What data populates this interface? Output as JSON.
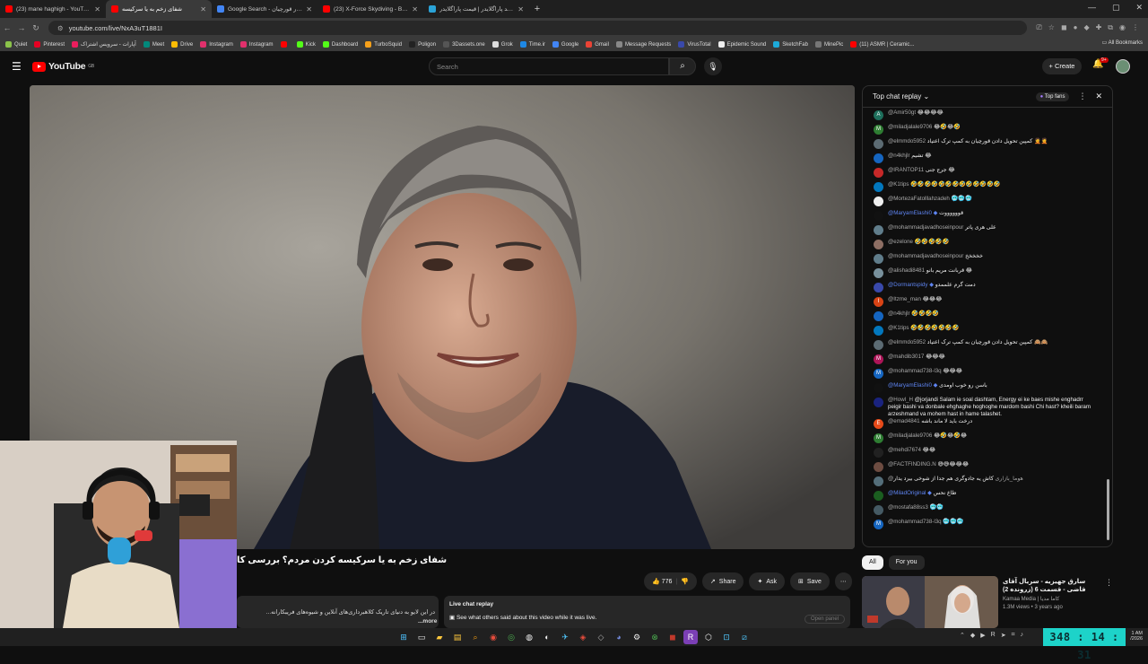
{
  "tabs": [
    {
      "title": "(23) mane haghigh - YouTube",
      "color": "#ff0000"
    },
    {
      "title": "شفای زخم به یا سرکیسه",
      "color": "#ff0000",
      "active": true
    },
    {
      "title": "Google Search - قرار قورچیان",
      "color": "#4285f4"
    },
    {
      "title": "(23) X-Force Skydiving - Brad P",
      "color": "#ff0000"
    },
    {
      "title": "خرید پاراگلایدر | قیمت پاراگلایدر",
      "color": "#2aa3d7"
    }
  ],
  "new_tab": "+",
  "window_controls": [
    "—",
    "▢",
    "✕"
  ],
  "address": {
    "url": "youtube.com/live/NxA3uT1881I"
  },
  "bookmarks": [
    {
      "label": "Quiet",
      "color": "#8bc34a"
    },
    {
      "label": "Pinterest",
      "color": "#e60023"
    },
    {
      "label": "آپارات - سرویس اشتراک",
      "color": "#ea1d5d"
    },
    {
      "label": "Meet",
      "color": "#00897b"
    },
    {
      "label": "Drive",
      "color": "#fbbc04"
    },
    {
      "label": "Instagram",
      "color": "#e1306c"
    },
    {
      "label": "Instagram",
      "color": "#e1306c"
    },
    {
      "label": "",
      "color": "#ff0000"
    },
    {
      "label": "Kick",
      "color": "#53fc18"
    },
    {
      "label": "Dashboard",
      "color": "#53fc18"
    },
    {
      "label": "TurboSquid",
      "color": "#f6a01a"
    },
    {
      "label": "Poligon",
      "color": "#222"
    },
    {
      "label": "3Dassets.one",
      "color": "#555"
    },
    {
      "label": "Grok",
      "color": "#ddd"
    },
    {
      "label": "Time.ir",
      "color": "#1e88e5"
    },
    {
      "label": "Google",
      "color": "#4285f4"
    },
    {
      "label": "Gmail",
      "color": "#ea4335"
    },
    {
      "label": "Message Requests",
      "color": "#888"
    },
    {
      "label": "VirusTotal",
      "color": "#3949ab"
    },
    {
      "label": "Epidemic Sound",
      "color": "#eee"
    },
    {
      "label": "SketchFab",
      "color": "#1caad9"
    },
    {
      "label": "MinePic",
      "color": "#777"
    },
    {
      "label": "(11) ASMR | Ceramic...",
      "color": "#ff0000"
    }
  ],
  "all_bookmarks": "All Bookmarks",
  "yt": {
    "logo": "YouTube",
    "region": "GB",
    "search_placeholder": "Search",
    "create": "Create",
    "notif_count": "9+"
  },
  "video": {
    "title": "شفای زخم به یا سرکیسه کردن مردم؟ بررسی کا",
    "likes": "776",
    "share": "Share",
    "ask": "Ask",
    "save": "Save",
    "description": "در این لایو به دنیای تاریک کلاهبرداری‌های آنلاین و شیوه‌های فریبکارانه...",
    "more": "...more"
  },
  "live_chat_replay": {
    "heading": "Live chat replay",
    "text": "See what others said about this video while it was live.",
    "button": "Open panel"
  },
  "chat": {
    "header": "Top chat replay",
    "top_fans": "Top fans",
    "messages": [
      {
        "name": "@Amir50gt",
        "text": "😂😂😂😂",
        "color": "#1e6f5c",
        "initial": "A"
      },
      {
        "name": "@miladjalale9706",
        "text": "😂🤣😂🤣",
        "color": "#2e7d32",
        "initial": "M"
      },
      {
        "name": "@elmmdo5952",
        "text": "کمپین تحویل دادن قورچیان به کمپ ترک اعتیاد 🤦🤦",
        "color": "#5c6b73",
        "initial": ""
      },
      {
        "name": "@n4khjlr",
        "text": "تشیم 😂",
        "color": "#1565c0",
        "initial": ""
      },
      {
        "name": "@IRANTOP11",
        "text": "جرج جنی 😂",
        "color": "#c62828",
        "initial": ""
      },
      {
        "name": "@K1tips",
        "text": "🤣🤣🤣🤣🤣🤣🤣🤣🤣🤣🤣🤣🤣",
        "color": "#0277bd",
        "initial": ""
      },
      {
        "name": "@MortezaFatolllahzadeh",
        "text": "🥶🥶🥶",
        "color": "#eeeeee",
        "initial": ""
      },
      {
        "name": "@MaryamElashi0",
        "text": "قووووووت",
        "color": "#111111",
        "initial": "",
        "member": true
      },
      {
        "name": "@mohammadjavadhoseinpour",
        "text": "علی هری پاتر",
        "color": "#607d8b",
        "initial": ""
      },
      {
        "name": "@ezelone",
        "text": "🤣🤣🤣🤣🤣",
        "color": "#8d6e63",
        "initial": ""
      },
      {
        "name": "@mohammadjavadhoseinpour",
        "text": "خخخخخ",
        "color": "#607d8b",
        "initial": ""
      },
      {
        "name": "@alishadi8481",
        "text": "قربانت مریم بانو 😂",
        "color": "#78909c",
        "initial": ""
      },
      {
        "name": "@Dormantspidy",
        "text": "دمت گرم علممدو",
        "color": "#3949ab",
        "initial": "",
        "member": true
      },
      {
        "name": "@Itzme_man",
        "text": "😂😂😂",
        "color": "#d84315",
        "initial": "I"
      },
      {
        "name": "@n4khjlr",
        "text": "🤣🤣🤣🤣",
        "color": "#1565c0",
        "initial": ""
      },
      {
        "name": "@K1tips",
        "text": "🤣🤣🤣🤣🤣🤣🤣",
        "color": "#0277bd",
        "initial": ""
      },
      {
        "name": "@elmmdo5952",
        "text": "کمپین تحویل دادن قورچیان به کمپ ترک اعتیاد 🙈🙈",
        "color": "#5c6b73",
        "initial": ""
      },
      {
        "name": "@mahdib3017",
        "text": "😂😂😂",
        "color": "#ad1457",
        "initial": "M"
      },
      {
        "name": "@mohammad738-l3q",
        "text": "😂😂😂",
        "color": "#1565c0",
        "initial": "M"
      },
      {
        "name": "@MaryamElashi0",
        "text": "باسن رو خوب اومدی",
        "color": "#111111",
        "initial": "",
        "member": true
      },
      {
        "name": "@Howl_H",
        "text": "@jorjandi Salam ie soal dashtam, Energy ei ke baes mishe enghadrr peigir bashi va donbale ehghaghe hoghoghe mardom bashi Chi hast? kheili baram arzeshmand va mohem hast in hame talashet.",
        "color": "#1a237e",
        "initial": ""
      },
      {
        "name": "@emad4841",
        "text": "درخت باید لا ماند باشه",
        "color": "#e64a19",
        "initial": "E"
      },
      {
        "name": "@miladjalale9706",
        "text": "😂🤣😂🤣😂",
        "color": "#2e7d32",
        "initial": "M"
      },
      {
        "name": "@mehdi7674",
        "text": "😂😂",
        "color": "#212121",
        "initial": ""
      },
      {
        "name": "@FACTFINDING.N",
        "text": "😅😅😂😂😂",
        "color": "#6d4c41",
        "initial": ""
      },
      {
        "name": "@هوما_بازاری",
        "text": "کاش یه جادوگری هم جدا از شوخی بیرد یدار",
        "color": "#546e7a",
        "initial": ""
      },
      {
        "name": "@MiladOriginal",
        "text": "طاع نحس",
        "color": "#1b5e20",
        "initial": "",
        "member": true
      },
      {
        "name": "@mostafa88ss3",
        "text": "🥶🥶",
        "color": "#455a64",
        "initial": ""
      },
      {
        "name": "@mohammad738-l3q",
        "text": "🥶🥶🥶",
        "color": "#1565c0",
        "initial": "M"
      }
    ]
  },
  "chips": [
    "All",
    "For you"
  ],
  "recommended": {
    "title": "سارق جهیزیه - سریال آقای قاضی - قسمت 6 (زرونده 2)",
    "channel": "Kamaa Media | کاما مدیا",
    "stats": "1.3M views • 3 years ago"
  },
  "taskbar": {
    "clock": "348 : 14 : 31",
    "time": "1 AM",
    "date": "/2026"
  }
}
